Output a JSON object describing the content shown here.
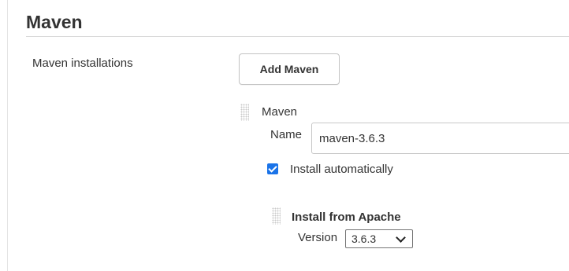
{
  "section": {
    "title": "Maven"
  },
  "field": {
    "label": "Maven installations"
  },
  "toolbar": {
    "add_label": "Add Maven"
  },
  "installation": {
    "title": "Maven",
    "name_label": "Name",
    "name_value": "maven-3.6.3",
    "install_auto_label": "Install automatically",
    "install_auto_checked": true,
    "installer": {
      "title": "Install from Apache",
      "version_label": "Version",
      "version_value": "3.6.3"
    }
  },
  "colors": {
    "checkbox_accent": "#1a73e8",
    "text": "#333333"
  },
  "icons": {
    "drag_handle": "drag-handle-icon",
    "dropdown": "chevron-down-icon",
    "check": "checkmark-icon"
  }
}
